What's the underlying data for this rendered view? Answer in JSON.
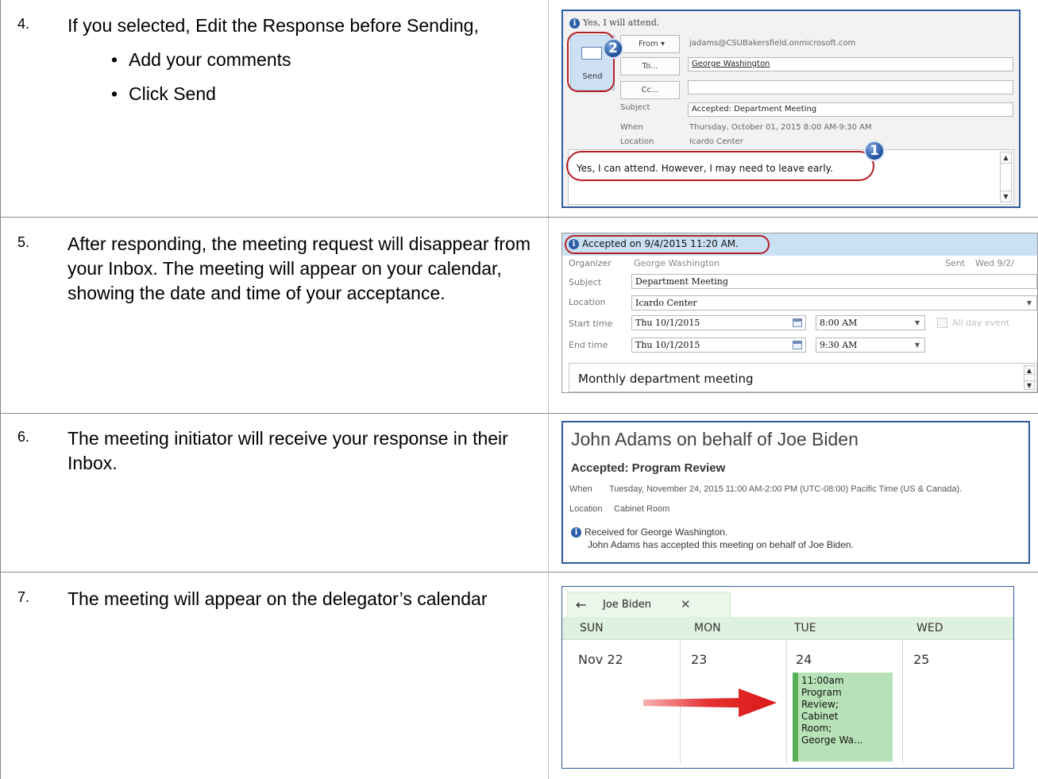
{
  "steps": [
    {
      "num": "4.",
      "text": "If you selected, Edit the Response before Sending,",
      "bullets": [
        "Add your comments",
        "Click Send"
      ]
    },
    {
      "num": "5.",
      "text": "After responding, the meeting request will disappear from your Inbox. The meeting will appear on your calendar, showing the date and time of your acceptance."
    },
    {
      "num": "6.",
      "text": "The meeting initiator will receive your response in their Inbox."
    },
    {
      "num": "7.",
      "text": "The meeting will appear on the delegator’s calendar"
    }
  ],
  "shot1": {
    "info": "Yes, I will attend.",
    "send_label": "Send",
    "from_label": "From",
    "from_value": "jadams@CSUBakersfield.onmicrosoft.com",
    "to_label": "To...",
    "to_value": "George Washington",
    "cc_label": "Cc...",
    "cc_value": "",
    "subject_label": "Subject",
    "subject_value": "Accepted: Department Meeting",
    "when_label": "When",
    "when_value": "Thursday, October 01, 2015 8:00 AM-9:30 AM",
    "location_label": "Location",
    "location_value": "Icardo Center",
    "body": "Yes, I can attend. However, I may need to leave early.",
    "callout1": "1",
    "callout2": "2"
  },
  "shot2": {
    "info": "Accepted on 9/4/2015 11:20 AM.",
    "organizer_label": "Organizer",
    "organizer_value": "George Washington",
    "sent_label": "Sent",
    "sent_value": "Wed 9/2/",
    "subject_label": "Subject",
    "subject_value": "Department Meeting",
    "location_label": "Location",
    "location_value": "Icardo Center",
    "start_label": "Start time",
    "start_date": "Thu 10/1/2015",
    "start_time": "8:00 AM",
    "allday_label": "All day event",
    "end_label": "End time",
    "end_date": "Thu 10/1/2015",
    "end_time": "9:30 AM",
    "body": "Monthly department meeting"
  },
  "shot3": {
    "from": "John Adams on behalf of Joe Biden",
    "subject": "Accepted: Program Review",
    "when_label": "When",
    "when_value": "Tuesday, November 24, 2015 11:00 AM-2:00 PM (UTC-08:00) Pacific Time (US & Canada).",
    "location_label": "Location",
    "location_value": "Cabinet Room",
    "note_line1": "Received for George Washington.",
    "note_line2": "John Adams has accepted this meeting on behalf of Joe Biden."
  },
  "shot4": {
    "tab_name": "Joe Biden",
    "back_icon": "←",
    "close_icon": "✕",
    "days": [
      "SUN",
      "MON",
      "TUE",
      "WED"
    ],
    "dates": [
      "Nov 22",
      "23",
      "24",
      "25"
    ],
    "event": "11:00am\nProgram\nReview;\nCabinet\nRoom;\nGeorge Wa...",
    "event_color": "#b7e2b7",
    "arrow_color": "#e02020"
  }
}
